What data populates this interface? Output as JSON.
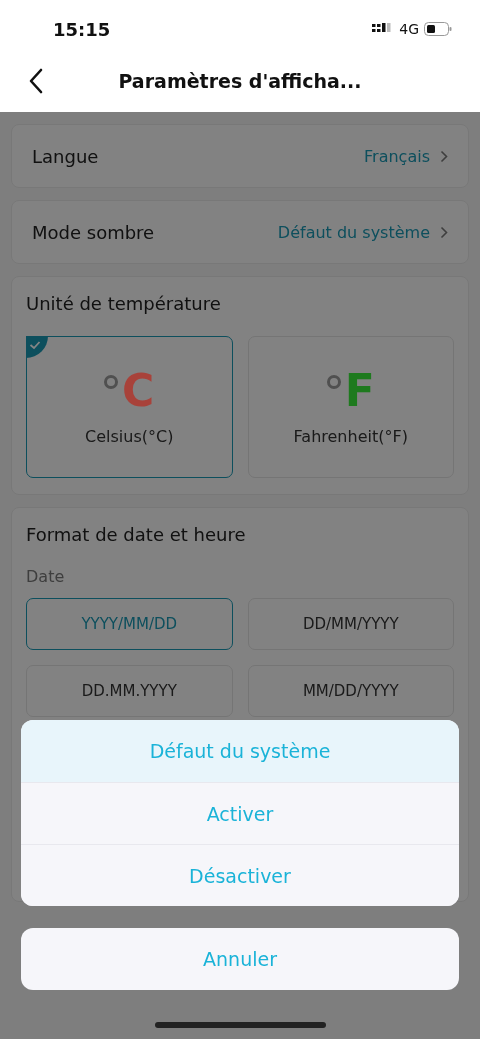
{
  "status_bar": {
    "time": "15:15",
    "network": "4G"
  },
  "header": {
    "title": "Paramètres d'afficha..."
  },
  "settings": [
    {
      "label": "Langue",
      "value": "Français"
    },
    {
      "label": "Mode sombre",
      "value": "Défaut du système"
    }
  ],
  "temperature": {
    "title": "Unité de température",
    "options": [
      {
        "symbol": "C",
        "label": "Celsius(°C)",
        "color": "#a8423a",
        "selected": true
      },
      {
        "symbol": "F",
        "label": "Fahrenheit(°F)",
        "color": "#1e7a1e",
        "selected": false
      }
    ]
  },
  "date_format": {
    "title": "Format de date et heure",
    "subtitle": "Date",
    "options": [
      {
        "label": "YYYY/MM/DD",
        "selected": true
      },
      {
        "label": "DD/MM/YYYY",
        "selected": false
      },
      {
        "label": "DD.MM.YYYY",
        "selected": false
      },
      {
        "label": "MM/DD/YYYY",
        "selected": false
      }
    ]
  },
  "action_sheet": {
    "options": [
      {
        "label": "Défaut du système",
        "selected": true
      },
      {
        "label": "Activer",
        "selected": false
      },
      {
        "label": "Désactiver",
        "selected": false
      }
    ],
    "cancel": "Annuler"
  }
}
